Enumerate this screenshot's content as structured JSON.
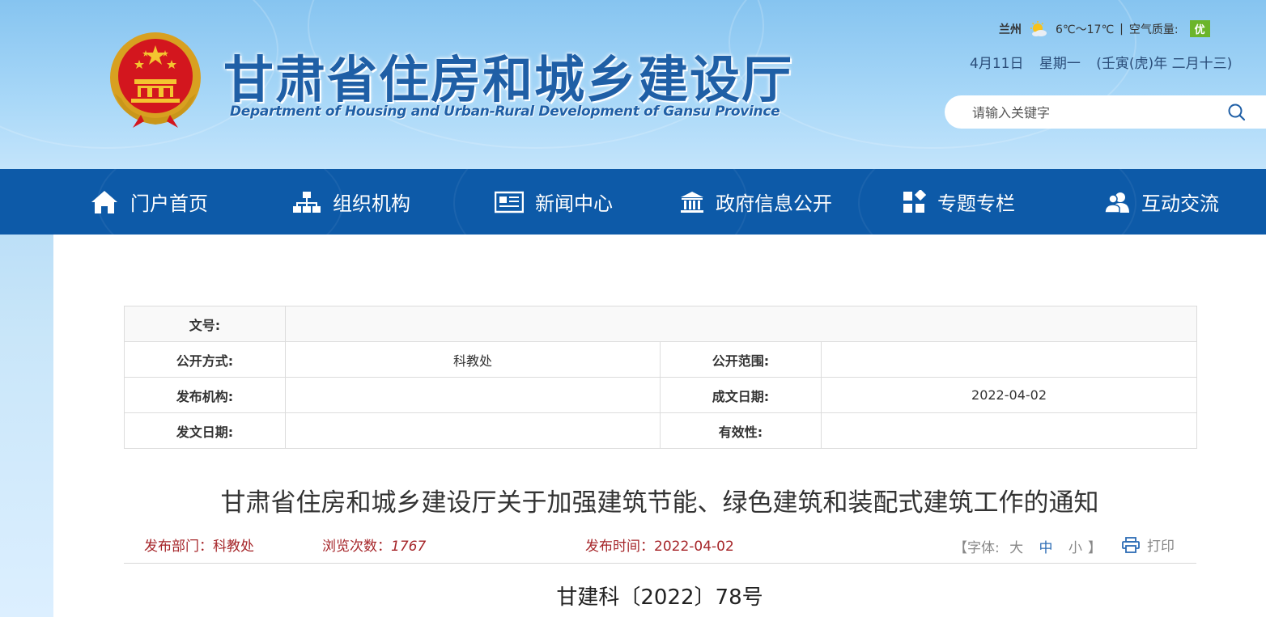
{
  "header": {
    "title": "甘肃省住房和城乡建设厅",
    "subtitle": "Department of Housing and Urban-Rural Development of Gansu Province",
    "weather": {
      "city": "兰州",
      "icon": "sunny-cloud-icon",
      "temperature": "6℃～17℃",
      "separator": "|",
      "air_quality_label": "空气质量:",
      "air_quality_value": "优"
    },
    "date": {
      "day": "4月11日",
      "weekday": "星期一",
      "lunar": "(壬寅(虎)年 二月十三)"
    },
    "search": {
      "placeholder": "请输入关键字",
      "button_icon": "search-icon"
    }
  },
  "nav": {
    "items": [
      {
        "label": "门户首页",
        "icon": "home-icon"
      },
      {
        "label": "组织机构",
        "icon": "org-chart-icon"
      },
      {
        "label": "新闻中心",
        "icon": "newspaper-icon"
      },
      {
        "label": "政府信息公开",
        "icon": "government-building-icon"
      },
      {
        "label": "专题专栏",
        "icon": "grid-icon"
      },
      {
        "label": "互动交流",
        "icon": "users-icon"
      }
    ]
  },
  "meta": {
    "doc_no_label": "文号:",
    "doc_no_value": "",
    "public_method_label": "公开方式:",
    "public_method_value": "科教处",
    "public_scope_label": "公开范围:",
    "public_scope_value": "",
    "issuer_label": "发布机构:",
    "issuer_value": "",
    "written_date_label": "成文日期:",
    "written_date_value": "2022-04-02",
    "issue_date_label": "发文日期:",
    "issue_date_value": "",
    "validity_label": "有效性:",
    "validity_value": ""
  },
  "article": {
    "title": "甘肃省住房和城乡建设厅关于加强建筑节能、绿色建筑和装配式建筑工作的通知",
    "dept_label": "发布部门：",
    "dept_value": "科教处",
    "views_label": "浏览次数：",
    "views_value": "1767",
    "time_label": "发布时间：",
    "time_value": "2022-04-02",
    "font_open": "【",
    "font_label": "字体:",
    "font_large": "大",
    "font_medium": "中",
    "font_small": "小",
    "font_close": "】",
    "print_label": "打印",
    "doc_number": "甘建科〔2022〕78号"
  },
  "colors": {
    "nav_bg": "#0d5aa8",
    "title_blue": "#1f5fa6",
    "info_red": "#a6262a",
    "air_quality_green": "#6bb52a"
  }
}
